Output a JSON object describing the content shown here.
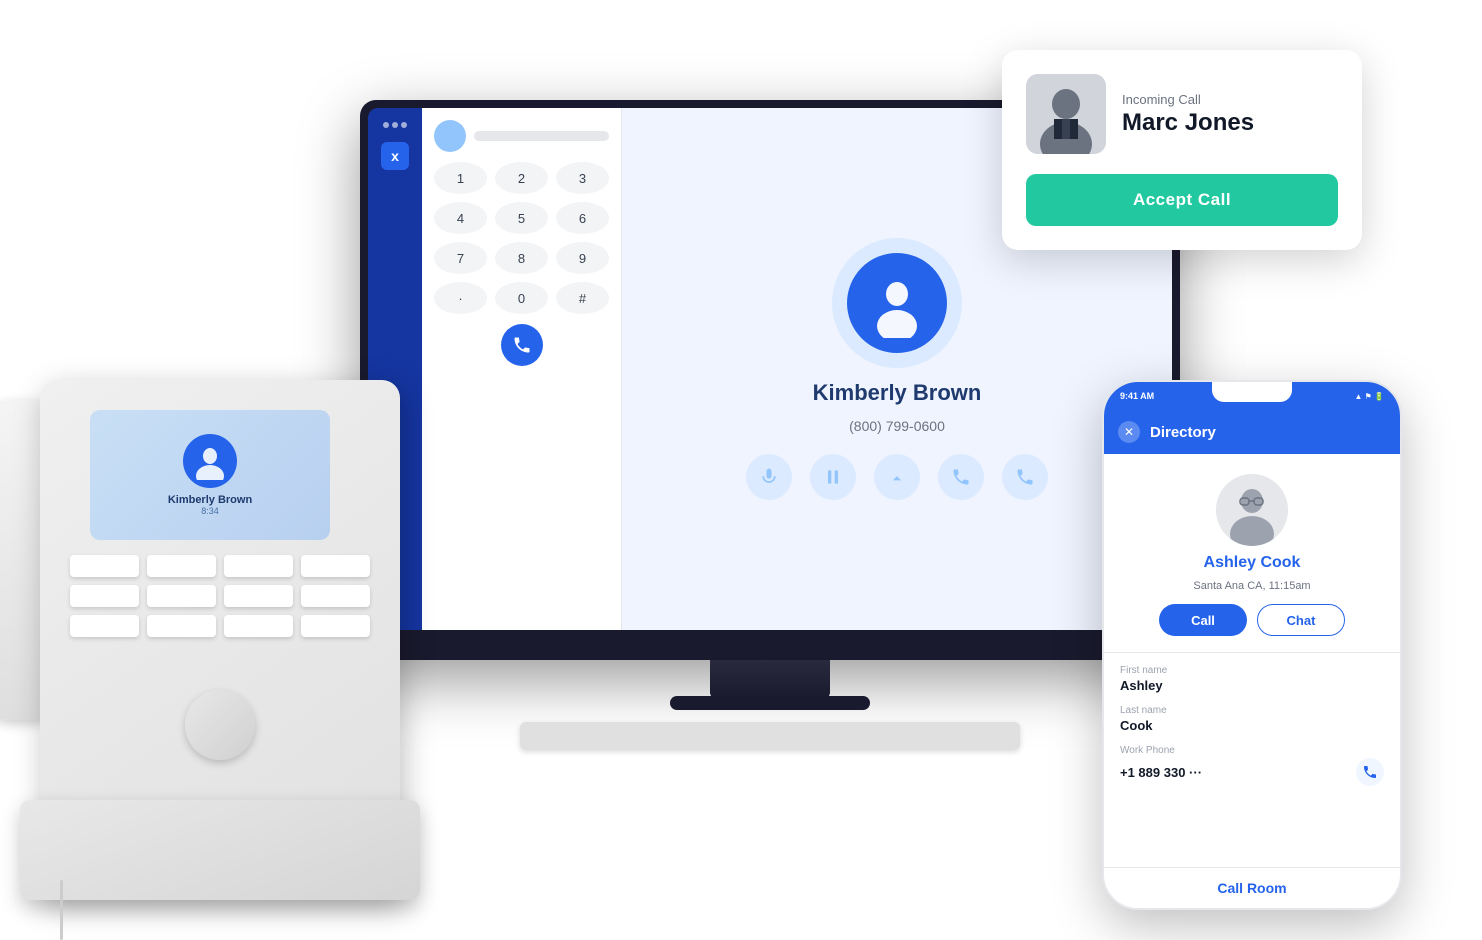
{
  "scene": {
    "background": "#ffffff"
  },
  "incoming_call": {
    "label": "Incoming Call",
    "caller_name": "Marc Jones",
    "accept_button": "Accept Call"
  },
  "desktop_app": {
    "dialpad": {
      "keys": [
        "1",
        "2",
        "3",
        "4",
        "5",
        "6",
        "7",
        "8",
        "9",
        ".",
        "0",
        "#"
      ]
    },
    "call_screen": {
      "contact_name": "Kimberly Brown",
      "contact_phone": "(800) 799-0600"
    },
    "sidebar": {
      "logo_text": "x"
    }
  },
  "desk_phone": {
    "screen_name": "Kimberly Brown",
    "screen_sub": "8:34"
  },
  "mobile_app": {
    "status_bar": {
      "time": "9:41 AM"
    },
    "header": {
      "title": "Directory",
      "close_icon": "✕"
    },
    "contact": {
      "name": "Ashley Cook",
      "location": "Santa Ana CA, 11:15am"
    },
    "action_buttons": {
      "call": "Call",
      "chat": "Chat"
    },
    "fields": {
      "first_name_label": "First name",
      "first_name_value": "Ashley",
      "last_name_label": "Last name",
      "last_name_value": "Cook",
      "work_phone_label": "Work Phone",
      "work_phone_value": "+1 889 330 ···"
    },
    "call_room_label": "Call Room"
  }
}
